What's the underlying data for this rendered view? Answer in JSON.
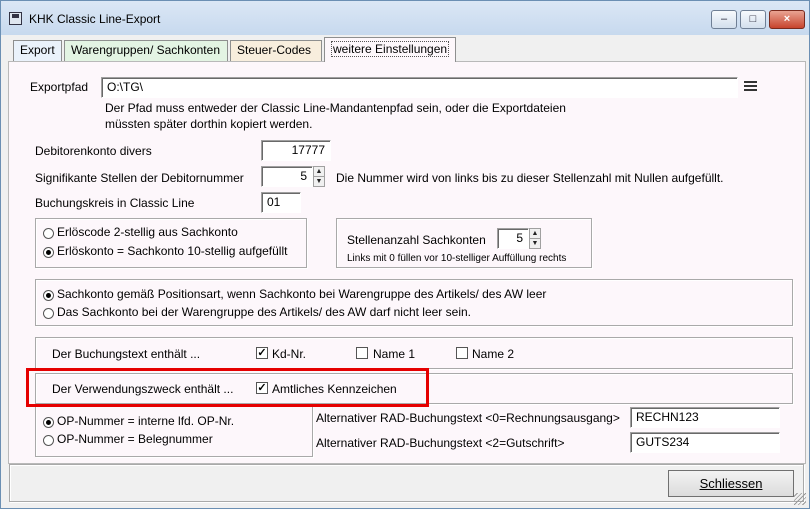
{
  "window": {
    "title": "KHK Classic Line-Export",
    "icon": "floppy-disk-icon"
  },
  "tabs": [
    "Export",
    "Warengruppen/ Sachkonten",
    "Steuer-Codes",
    "weitere Einstellungen"
  ],
  "export": {
    "path_label": "Exportpfad",
    "path_value": "O:\\TG\\",
    "path_hint_1": "Der Pfad muss entweder der Classic Line-Mandantenpfad sein, oder die Exportdateien",
    "path_hint_2": "müssten später dorthin kopiert werden.",
    "browse_icon": "list-icon"
  },
  "debitor": {
    "label": "Debitorenkonto divers",
    "value": "17777",
    "digits_label": "Signifikante Stellen der Debitornummer",
    "digits_value": "5",
    "digits_hint": "Die Nummer wird von links bis zu dieser Stellenzahl mit Nullen aufgefüllt."
  },
  "booking": {
    "label": "Buchungskreis in Classic Line",
    "value": "01"
  },
  "revenue": {
    "option_1": "Erlöscode 2-stellig aus Sachkonto",
    "option_2": "Erlöskonto = Sachkonto 10-stellig aufgefüllt",
    "selected": 2
  },
  "accounts": {
    "label": "Stellenanzahl Sachkonten",
    "value": "5",
    "hint": "Links mit 0 füllen vor 10-stelliger Auffüllung rechts"
  },
  "sachkonto": {
    "option_1": "Sachkonto gemäß Positionsart, wenn Sachkonto bei Warengruppe des Artikels/ des AW leer",
    "option_2": "Das Sachkonto bei der Warengruppe des Artikels/ des AW darf nicht leer sein.",
    "selected": 1
  },
  "booking_text": {
    "label": "Der Buchungstext enthält ...",
    "kd_nr": "Kd-Nr.",
    "name1": "Name 1",
    "name2": "Name 2",
    "kd_nr_checked": true,
    "name1_checked": false,
    "name2_checked": false
  },
  "purpose": {
    "label": "Der Verwendungszweck enthält ...",
    "plate": "Amtliches Kennzeichen",
    "plate_checked": true
  },
  "op": {
    "option_1": "OP-Nummer = interne lfd. OP-Nr.",
    "option_2": "OP-Nummer = Belegnummer",
    "selected": 1
  },
  "rad": {
    "label_0": "Alternativer RAD-Buchungstext <0=Rechnungsausgang>",
    "value_0": "RECHN123",
    "label_2": "Alternativer RAD-Buchungstext <2=Gutschrift>",
    "value_2": "GUTS234"
  },
  "footer": {
    "close_label": "Schliessen"
  },
  "check_mark": "✓",
  "spin_up": "▲",
  "spin_down": "▼",
  "highlight_color": "#e50000"
}
